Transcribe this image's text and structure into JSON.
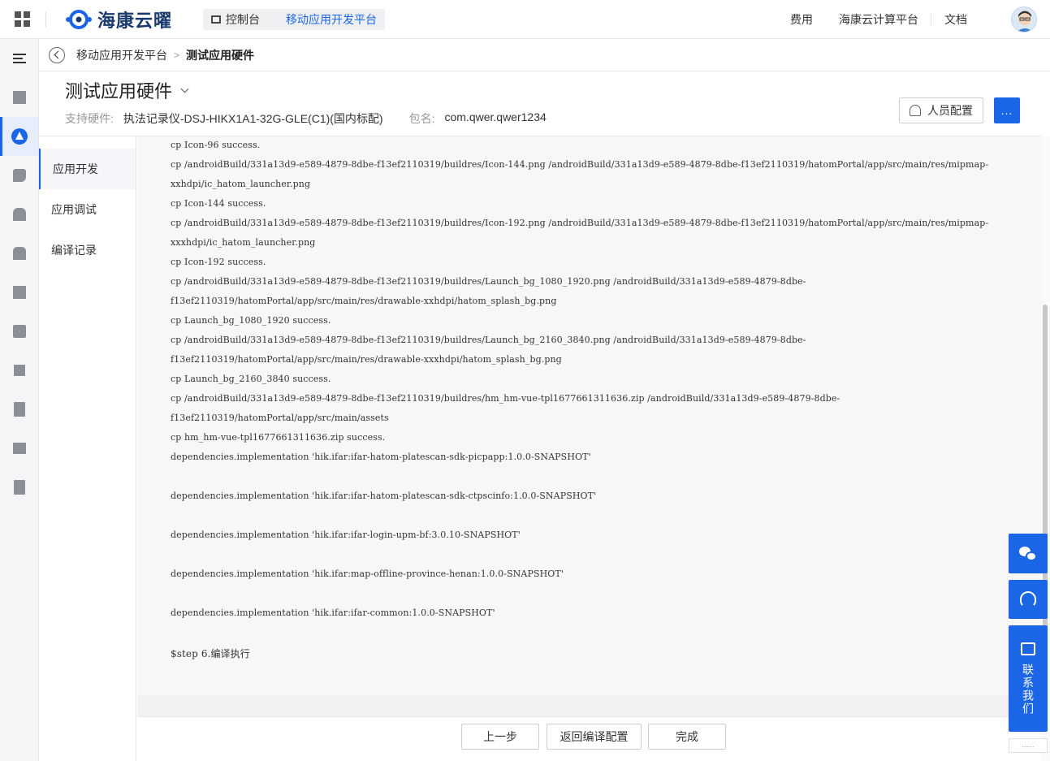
{
  "topbar": {
    "brand": "海康云曜",
    "console_tab": "控制台",
    "mobile_tab": "移动应用开发平台",
    "links": [
      "费用",
      "海康云计算平台",
      "文档"
    ]
  },
  "breadcrumb": {
    "parent": "移动应用开发平台",
    "sep": ">",
    "current": "测试应用硬件"
  },
  "header": {
    "title": "测试应用硬件",
    "hardware_label": "支持硬件:",
    "hardware_value": "执法记录仪-DSJ-HIKX1A1-32G-GLE(C1)(国内标配)",
    "package_label": "包名:",
    "package_value": "com.qwer.qwer1234",
    "people_button": "人员配置",
    "more_button": "..."
  },
  "subnav": [
    "应用开发",
    "应用调试",
    "编译记录"
  ],
  "log_lines": [
    "cp Icon-96 success.",
    "cp /androidBuild/331a13d9-e589-4879-8dbe-f13ef2110319/buildres/Icon-144.png /androidBuild/331a13d9-e589-4879-8dbe-f13ef2110319/hatomPortal/app/src/main/res/mipmap-",
    "xxhdpi/ic_hatom_launcher.png",
    "cp Icon-144 success.",
    "cp /androidBuild/331a13d9-e589-4879-8dbe-f13ef2110319/buildres/Icon-192.png /androidBuild/331a13d9-e589-4879-8dbe-f13ef2110319/hatomPortal/app/src/main/res/mipmap-",
    "xxxhdpi/ic_hatom_launcher.png",
    "cp Icon-192 success.",
    "cp /androidBuild/331a13d9-e589-4879-8dbe-f13ef2110319/buildres/Launch_bg_1080_1920.png /androidBuild/331a13d9-e589-4879-8dbe-",
    "f13ef2110319/hatomPortal/app/src/main/res/drawable-xxhdpi/hatom_splash_bg.png",
    "cp Launch_bg_1080_1920 success.",
    "cp /androidBuild/331a13d9-e589-4879-8dbe-f13ef2110319/buildres/Launch_bg_2160_3840.png /androidBuild/331a13d9-e589-4879-8dbe-",
    "f13ef2110319/hatomPortal/app/src/main/res/drawable-xxxhdpi/hatom_splash_bg.png",
    "cp Launch_bg_2160_3840 success.",
    "cp /androidBuild/331a13d9-e589-4879-8dbe-f13ef2110319/buildres/hm_hm-vue-tpl1677661311636.zip /androidBuild/331a13d9-e589-4879-8dbe-",
    "f13ef2110319/hatomPortal/app/src/main/assets",
    "cp hm_hm-vue-tpl1677661311636.zip success.",
    "dependencies.implementation 'hik.ifar:ifar-hatom-platescan-sdk-picpapp:1.0.0-SNAPSHOT'",
    "",
    "dependencies.implementation 'hik.ifar:ifar-hatom-platescan-sdk-ctpscinfo:1.0.0-SNAPSHOT'",
    "",
    "dependencies.implementation 'hik.ifar:ifar-login-upm-bf:3.0.10-SNAPSHOT'",
    "",
    "dependencies.implementation 'hik.ifar:map-offline-province-henan:1.0.0-SNAPSHOT'",
    "",
    "dependencies.implementation 'hik.ifar:ifar-common:1.0.0-SNAPSHOT'",
    "",
    "$step 6.编译执行"
  ],
  "footer": {
    "prev": "上一步",
    "back": "返回编译配置",
    "done": "完成"
  },
  "float_tools": {
    "contact": "联系我们",
    "handle": "......"
  },
  "colors": {
    "accent": "#1a66e6"
  }
}
